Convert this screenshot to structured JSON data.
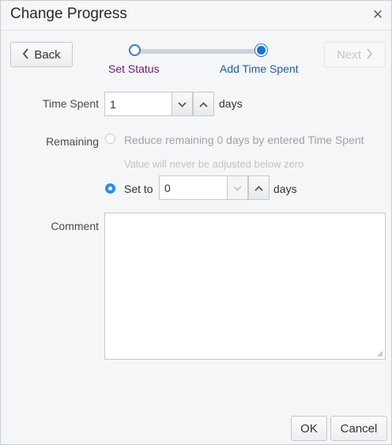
{
  "dialog": {
    "title": "Change Progress"
  },
  "icons": {
    "close": "close-icon",
    "back": "chevron-left-icon",
    "next": "chevron-right-icon",
    "up": "chevron-up-icon",
    "down": "chevron-down-icon"
  },
  "nav": {
    "back_label": "Back",
    "next_label": "Next"
  },
  "train": {
    "steps": [
      {
        "label": "Set Status",
        "state": "visited"
      },
      {
        "label": "Add Time Spent",
        "state": "current"
      }
    ]
  },
  "form": {
    "time_spent": {
      "label": "Time Spent",
      "value": "1",
      "unit": "days"
    },
    "remaining": {
      "label": "Remaining",
      "option_reduce": "Reduce remaining 0 days by entered Time Spent",
      "option_reduce_hint": "Value will never be adjusted below zero",
      "option_set": "Set to",
      "set_value": "0",
      "unit": "days",
      "selected": "set"
    },
    "comment": {
      "label": "Comment",
      "value": ""
    }
  },
  "footer": {
    "ok_label": "OK",
    "cancel_label": "Cancel"
  },
  "colors": {
    "accent": "#1a73d1",
    "visited_step": "#6c1a7a",
    "current_step": "#1f5f9e"
  }
}
